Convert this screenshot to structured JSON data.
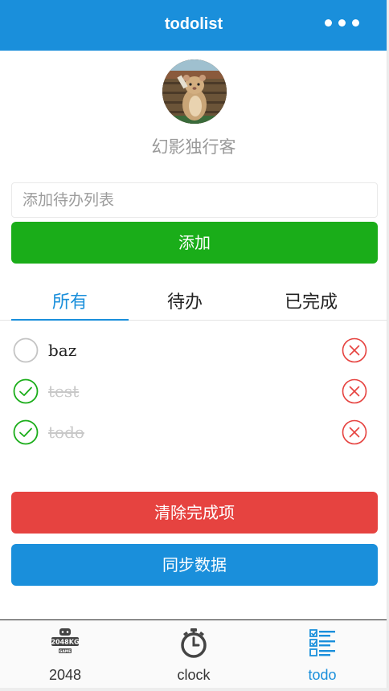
{
  "navbar": {
    "title": "todolist"
  },
  "profile": {
    "username": "幻影独行客"
  },
  "add_form": {
    "placeholder": "添加待办列表",
    "add_label": "添加"
  },
  "filter_tabs": [
    "所有",
    "待办",
    "已完成"
  ],
  "todos": [
    {
      "text": "baz",
      "done": false
    },
    {
      "text": "test",
      "done": true
    },
    {
      "text": "todo",
      "done": true
    }
  ],
  "actions": {
    "clear_label": "清除完成项",
    "sync_label": "同步数据"
  },
  "tabbar": {
    "items": [
      {
        "label": "2048",
        "icon": "game-2048-icon"
      },
      {
        "label": "clock",
        "icon": "stopwatch-icon"
      },
      {
        "label": "todo",
        "icon": "todo-list-icon"
      }
    ]
  },
  "colors": {
    "primary": "#1a8fdb",
    "add_button": "#1aad19",
    "clear_button": "#e64340",
    "done_check": "#1aad19",
    "delete": "#e64340"
  }
}
